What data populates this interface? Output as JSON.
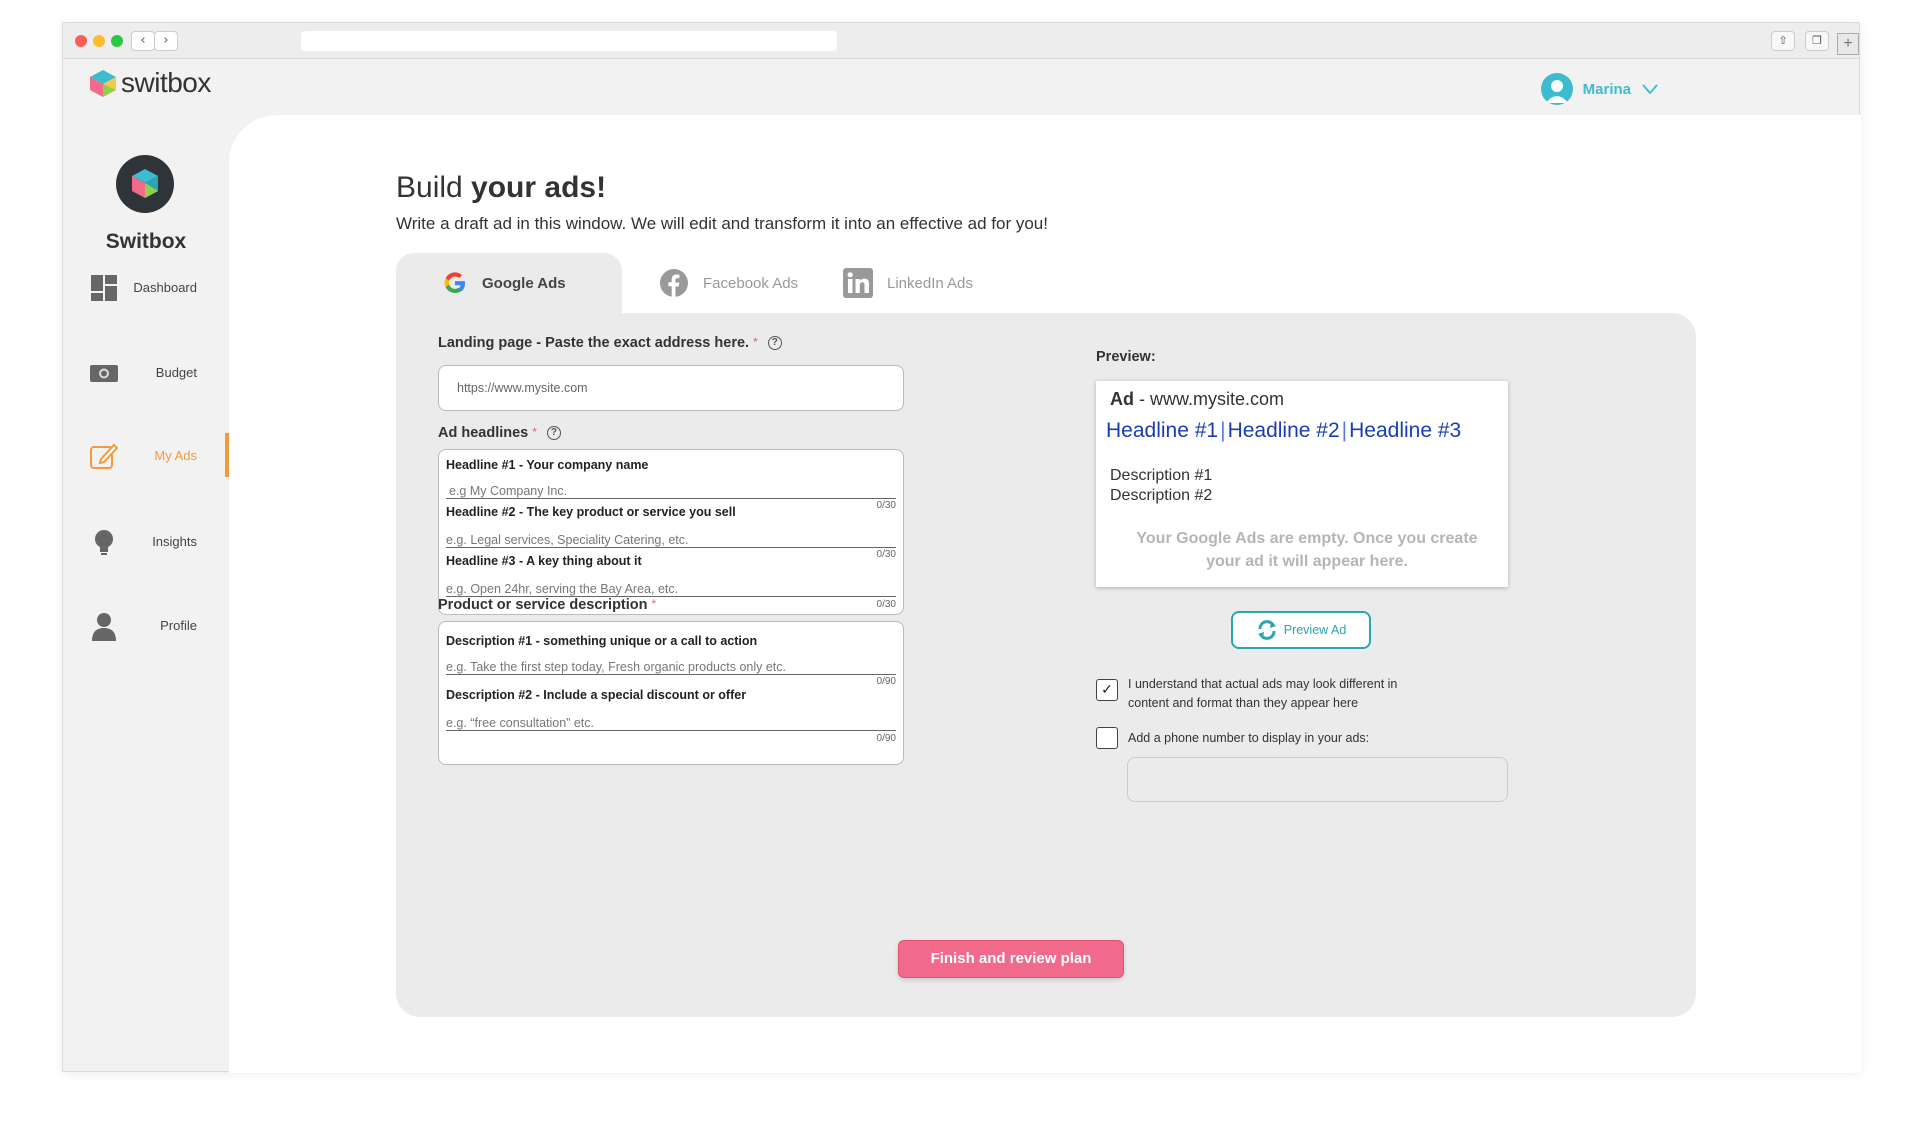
{
  "app": {
    "name": "switbox",
    "brand_title": "Switbox"
  },
  "user": {
    "name": "Marina"
  },
  "sidebar": {
    "items": [
      {
        "label": "Dashboard",
        "icon": "dashboard-icon"
      },
      {
        "label": "Budget",
        "icon": "money-icon"
      },
      {
        "label": "My Ads",
        "icon": "edit-icon",
        "active": true
      },
      {
        "label": "Insights",
        "icon": "lightbulb-icon"
      },
      {
        "label": "Profile",
        "icon": "user-icon"
      }
    ]
  },
  "page": {
    "title_light": "Build ",
    "title_bold": "your ads!",
    "subtitle": "Write a draft ad in this window. We will edit and transform it into an effective ad for you!"
  },
  "tabs": [
    {
      "label": "Google Ads",
      "active": true
    },
    {
      "label": "Facebook Ads",
      "active": false
    },
    {
      "label": "LinkedIn Ads",
      "active": false
    }
  ],
  "form": {
    "landing_label": "Landing page - Paste the exact address here.",
    "landing_placeholder": "https://www.mysite.com",
    "headlines_label": "Ad headlines",
    "headlines": [
      {
        "label": "Headline #1 - Your company name",
        "placeholder": "e.g My Company Inc.",
        "count": "0/30"
      },
      {
        "label": "Headline #2 - The key product or service you sell",
        "placeholder": "e.g. Legal services, Speciality Catering, etc.",
        "count": "0/30"
      },
      {
        "label": "Headline #3 - A key thing about it",
        "placeholder": "e.g. Open 24hr, serving the Bay Area, etc.",
        "count": "0/30"
      }
    ],
    "description_label": "Product or service description",
    "descriptions": [
      {
        "label": "Description #1 - something unique or a call to action",
        "placeholder": "e.g. Take the first step today, Fresh organic products only etc.",
        "count": "0/90"
      },
      {
        "label": "Description #2 - Include a special discount or offer",
        "placeholder": "e.g. “free consultation” etc.",
        "count": "0/90"
      }
    ],
    "required_mark": "*",
    "help_glyph": "?"
  },
  "preview": {
    "label": "Preview:",
    "ad_prefix": "Ad",
    "ad_url": " - www.mysite.com",
    "headline1": "Headline #1",
    "headline2": "Headline #2",
    "headline3": "Headline #3",
    "separator": "|",
    "desc1": "Description #1",
    "desc2": "Description #2",
    "empty_msg": "Your Google Ads are empty. Once you create your ad it will appear here.",
    "button": "Preview Ad"
  },
  "options": {
    "understand": {
      "label": "I understand that actual ads may look different in content and format than they appear here",
      "checked": true,
      "mark": "✓"
    },
    "phone": {
      "label": "Add a phone number to display in your ads:",
      "checked": false
    }
  },
  "finish_button": "Finish and review plan",
  "colors": {
    "accent_teal": "#3dbccf",
    "accent_orange": "#f39a3c",
    "cta_pink": "#f26a8b",
    "headline_blue": "#1a3db3"
  }
}
